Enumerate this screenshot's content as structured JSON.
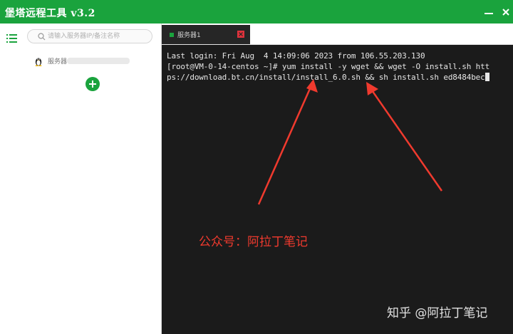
{
  "app": {
    "title": "堡塔远程工具 v3.2"
  },
  "sidebar": {
    "search_placeholder": "请输入服务器IP/备注名称",
    "servers": [
      {
        "name": "服务器"
      }
    ]
  },
  "tabs": [
    {
      "label": "服务器1"
    }
  ],
  "terminal": {
    "lines": [
      "Last login: Fri Aug  4 14:09:06 2023 from 106.55.203.130",
      "[root@VM-0-14-centos ~]# yum install -y wget && wget -O install.sh htt",
      "ps://download.bt.cn/install/install_6.0.sh && sh install.sh ed8484bec"
    ]
  },
  "annotation": {
    "text": "公众号：阿拉丁笔记",
    "color": "#f03a2e"
  },
  "watermark": {
    "text": "知乎 @阿拉丁笔记"
  },
  "colors": {
    "brand_green": "#1aa33d",
    "terminal_bg": "#1b1b1b",
    "tab_bg": "#262626",
    "tab_close": "#e0323c"
  },
  "icons": {
    "menu": "list-menu-icon",
    "search": "search-icon",
    "os": "linux-penguin-icon",
    "add": "plus-icon",
    "close": "close-icon",
    "minimize": "minimize-icon"
  }
}
